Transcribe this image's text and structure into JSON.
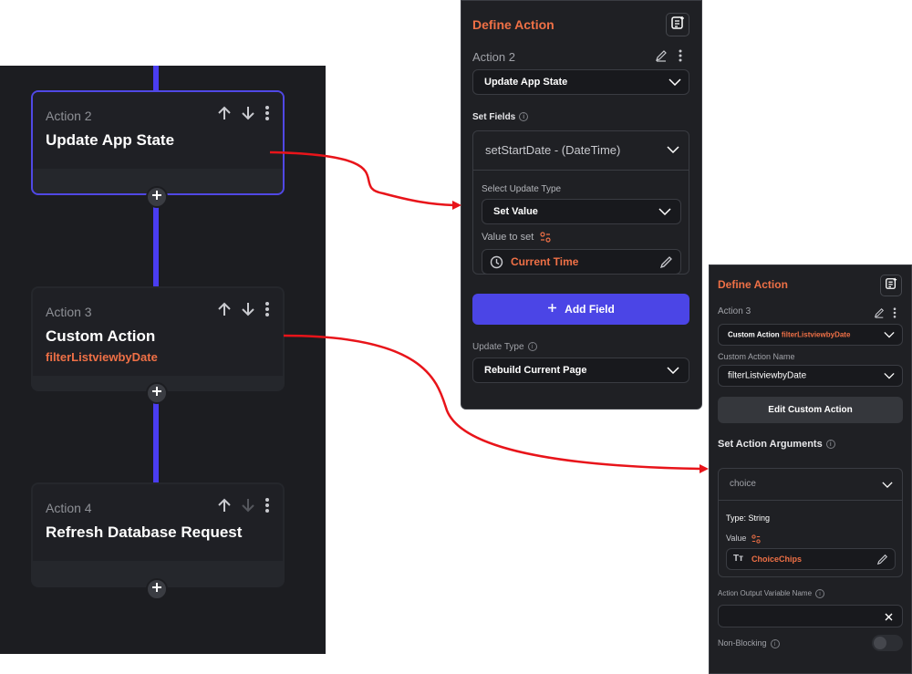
{
  "flow": {
    "actions": [
      {
        "step": "Action 2",
        "title": "Update App State",
        "subtitle": ""
      },
      {
        "step": "Action 3",
        "title": "Custom Action",
        "subtitle": "filterListviewbyDate"
      },
      {
        "step": "Action 4",
        "title": "Refresh Database Request",
        "subtitle": ""
      }
    ]
  },
  "panel1": {
    "title": "Define Action",
    "action_label": "Action 2",
    "action_type": "Update App State",
    "set_fields_label": "Set Fields",
    "field_name": "setStartDate - (DateTime)",
    "select_update_type_label": "Select Update Type",
    "update_type_value": "Set Value",
    "value_to_set_label": "Value to set",
    "value": "Current Time",
    "add_field_label": "Add Field",
    "update_type_label": "Update Type",
    "update_type_option": "Rebuild Current Page"
  },
  "panel2": {
    "title": "Define Action",
    "action_label": "Action 3",
    "action_type_prefix": "Custom Action",
    "action_type_name": "filterListviewbyDate",
    "custom_action_name_label": "Custom Action Name",
    "custom_action_name": "filterListviewbyDate",
    "edit_button": "Edit Custom Action",
    "set_args_label": "Set Action Arguments",
    "arg_name": "choice",
    "type_label": "Type: String",
    "value_label": "Value",
    "value": "ChoiceChips",
    "output_var_label": "Action Output Variable Name",
    "non_blocking_label": "Non-Blocking"
  },
  "colors": {
    "accent": "#4b45e6",
    "highlight": "#ef7046",
    "arrow": "#e8141a",
    "panel_bg": "#1f2024"
  }
}
